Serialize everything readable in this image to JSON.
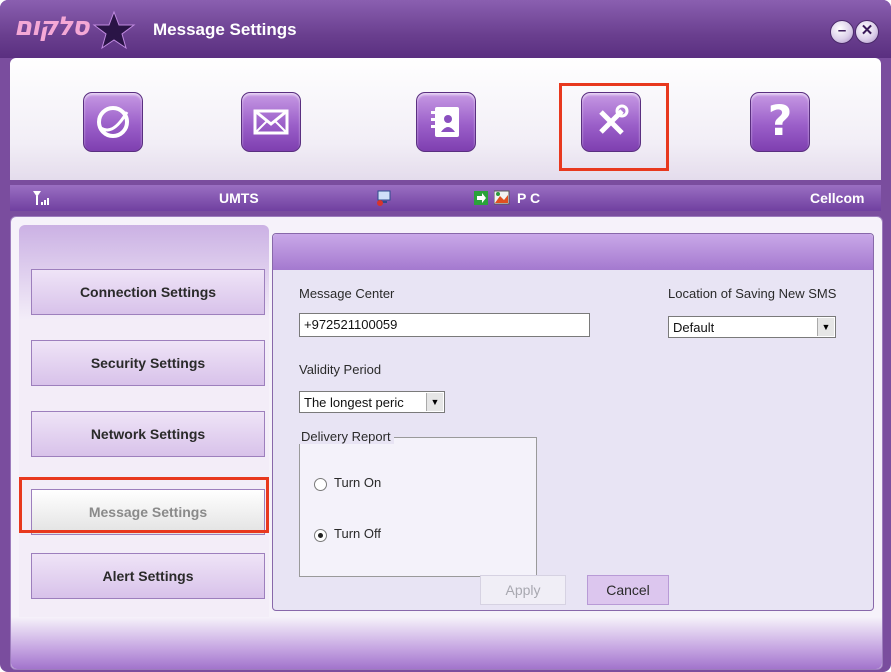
{
  "window": {
    "title": "Message Settings",
    "brand": "סלקום"
  },
  "toolbar": {
    "buttons": [
      {
        "name": "internet",
        "icon": "internet-icon"
      },
      {
        "name": "messages",
        "icon": "envelope-icon"
      },
      {
        "name": "contacts",
        "icon": "contacts-book-icon"
      },
      {
        "name": "settings",
        "icon": "tools-icon",
        "selected": true
      },
      {
        "name": "help",
        "icon": "help-icon",
        "label": "?"
      }
    ]
  },
  "status": {
    "network_type": "UMTS",
    "connection": "P C",
    "operator": "Cellcom"
  },
  "nav": {
    "items": [
      {
        "label": "Connection Settings"
      },
      {
        "label": "Security Settings"
      },
      {
        "label": "Network Settings"
      },
      {
        "label": "Message Settings",
        "active": true
      },
      {
        "label": "Alert Settings"
      }
    ]
  },
  "form": {
    "message_center": {
      "label": "Message Center",
      "value": "+972521100059"
    },
    "location": {
      "label": "Location of Saving New SMS",
      "value": "Default"
    },
    "validity": {
      "label": "Validity Period",
      "value": "The longest peric"
    },
    "delivery": {
      "legend": "Delivery Report",
      "on_label": "Turn On",
      "off_label": "Turn Off",
      "selected": "off"
    },
    "apply_label": "Apply",
    "cancel_label": "Cancel"
  },
  "colors": {
    "highlight": "#e8381e",
    "accent": "#9b5fc9"
  }
}
